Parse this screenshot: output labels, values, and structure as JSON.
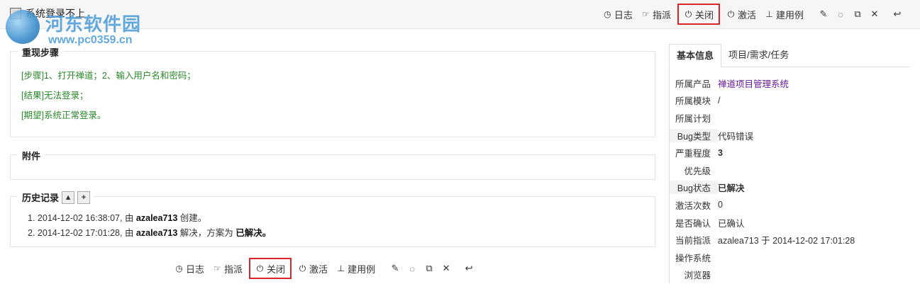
{
  "header": {
    "bug_id_badge": "",
    "title": "系统登录不上"
  },
  "watermark": {
    "name": "河东软件园",
    "url": "www.pc0359.cn"
  },
  "toolbar": {
    "log": "日志",
    "assign": "指派",
    "close": "关闭",
    "activate": "激活",
    "create_case": "建用例"
  },
  "icons": {
    "log": "clock-icon",
    "assign": "hand-point-icon",
    "close": "power-icon",
    "activate": "power-icon",
    "create_case": "sitemap-icon",
    "edit": "pencil-icon",
    "comment": "comment-icon",
    "copy": "copy-icon",
    "delete": "times-icon",
    "back": "undo-icon"
  },
  "steps": {
    "legend": "重现步骤",
    "lines": [
      "[步骤]1、打开禅道；2、输入用户名和密码；",
      "[结果]无法登录；",
      "[期望]系统正常登录。"
    ]
  },
  "attachments": {
    "legend": "附件"
  },
  "history": {
    "legend": "历史记录",
    "items": [
      {
        "num": "1.",
        "date": "2014-12-02 16:38:07",
        "by": ", 由 ",
        "user": "azalea713",
        "action": " 创建。",
        "extra": "",
        "result": ""
      },
      {
        "num": "2.",
        "date": "2014-12-02 17:01:28",
        "by": ", 由 ",
        "user": "azalea713",
        "action": " 解决，方案为 ",
        "extra": "",
        "result": "已解决。"
      }
    ]
  },
  "side": {
    "tabs": [
      "基本信息",
      "项目/需求/任务"
    ],
    "rows": [
      {
        "label": "所属产品",
        "value": "禅道项目管理系统",
        "style": "link"
      },
      {
        "label": "所属模块",
        "value": "/",
        "style": ""
      },
      {
        "label": "所属计划",
        "value": "",
        "style": ""
      },
      {
        "label": "Bug类型",
        "value": "代码错误",
        "style": "",
        "bg": true
      },
      {
        "label": "严重程度",
        "value": "3",
        "style": "bold"
      },
      {
        "label": "优先级",
        "value": "",
        "style": ""
      },
      {
        "label": "Bug状态",
        "value": "已解决",
        "style": "bold",
        "bg": true
      },
      {
        "label": "激活次数",
        "value": "0",
        "style": ""
      },
      {
        "label": "是否确认",
        "value": "已确认",
        "style": ""
      },
      {
        "label": "当前指派",
        "value": "azalea713 于 2014-12-02 17:01:28",
        "style": ""
      },
      {
        "label": "操作系统",
        "value": "",
        "style": ""
      },
      {
        "label": "浏览器",
        "value": "",
        "style": ""
      }
    ]
  },
  "colors": {
    "highlight": "#d9262b",
    "steps_text": "#2b8a2b",
    "product_link": "#6a1b9a"
  }
}
